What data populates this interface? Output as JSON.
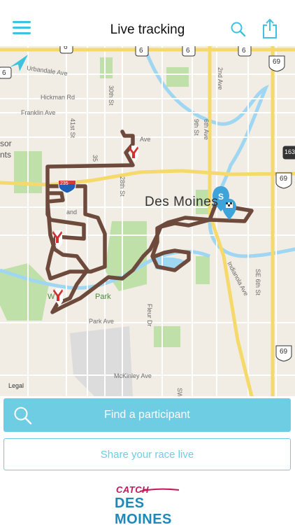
{
  "header": {
    "title": "Live tracking",
    "menu_icon": "hamburger-menu-icon",
    "search_icon": "search-icon",
    "share_icon": "share-icon",
    "accent_color": "#3ec2dd"
  },
  "map": {
    "city": "Des Moines",
    "streets": {
      "urbandale": "Urbandale Ave",
      "hickman": "Hickman Rd",
      "franklin": "Franklin Ave",
      "st41": "41st St",
      "st30": "30th St",
      "st35": "35",
      "st28": "28th St",
      "park": "Park Ave",
      "mckinley": "McKinley Ave",
      "fleur": "Fleur Dr",
      "indianola": "Indianola Ave",
      "se6th": "SE 6th St",
      "st9": "9th St",
      "st6": "6th Ave",
      "ave2": "2nd Ave",
      "ave_partial": "Ave",
      "grand": "and",
      "sw": "SW",
      "sor": "sor",
      "nts": "nts",
      "park_w": "W",
      "park_e": "Park",
      "legal": "Legal"
    },
    "shields": {
      "h6a": "6",
      "h6b": "6",
      "h6c": "6",
      "h6d": "6",
      "h6left": "6",
      "i235": "235",
      "us69a": "69",
      "us69b": "69",
      "us69c": "69",
      "i163": "163"
    },
    "route_color": "#6e4a3c",
    "start_marker": "S",
    "markers": [
      "runner-marker",
      "runner-marker",
      "runner-marker",
      "start-marker",
      "finish-flag-marker"
    ]
  },
  "find_button": {
    "label": "Find a participant",
    "icon": "search-icon"
  },
  "share_button": {
    "label": "Share your race live"
  },
  "logo": {
    "top": "CATCH",
    "bottom": "DES MOINES"
  }
}
